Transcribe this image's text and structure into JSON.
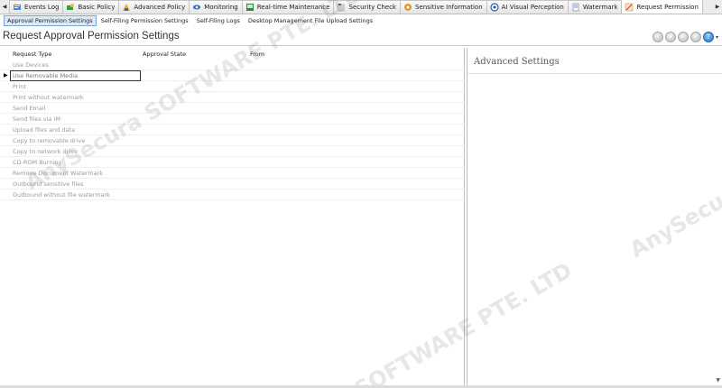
{
  "top_tabs": {
    "scroll_left": "◀",
    "scroll_right": "▶",
    "items": [
      {
        "label": "Events Log",
        "icon": "events-log-icon"
      },
      {
        "label": "Basic Policy",
        "icon": "basic-policy-icon"
      },
      {
        "label": "Advanced Policy",
        "icon": "advanced-policy-icon"
      },
      {
        "label": "Monitoring",
        "icon": "monitoring-icon"
      },
      {
        "label": "Real-time Maintenance",
        "icon": "real-time-maintenance-icon"
      },
      {
        "label": "Security Check",
        "icon": "security-check-icon"
      },
      {
        "label": "Sensitive Information",
        "icon": "sensitive-information-icon"
      },
      {
        "label": "AI Visual Perception",
        "icon": "ai-visual-perception-icon"
      },
      {
        "label": "Watermark",
        "icon": "watermark-icon"
      },
      {
        "label": "Request Permission",
        "icon": "request-permission-icon",
        "active": true
      }
    ]
  },
  "sub_tabs": [
    {
      "label": "Approval Permission Settings",
      "active": true
    },
    {
      "label": "Self-Filing Permission Settings"
    },
    {
      "label": "Self-Filing Logs"
    },
    {
      "label": "Desktop Management File Upload Settings"
    }
  ],
  "header": {
    "title": "Request Approval Permission Settings",
    "toolbar_icons": [
      "check-icon",
      "close-icon",
      "back-icon",
      "confirm-icon",
      "help-icon"
    ],
    "toolbar_caret": "▾"
  },
  "grid": {
    "columns": [
      "Request Type",
      "Approval State",
      "From"
    ],
    "selected_row": 1,
    "row_pointer": "▶",
    "rows": [
      "Use Devices",
      "Use Removable Media",
      "Print",
      "Print without watermark",
      "Send Email",
      "Send files via IM",
      "Upload files and data",
      "Copy to removable drive",
      "Copy to network drive",
      "CD-ROM Burning",
      "Remove Document Watermark",
      "Outbound sensitive files",
      "Outbound without file watermark"
    ]
  },
  "advanced_panel": {
    "title": "Advanced Settings",
    "scroll_down": "▼"
  },
  "watermarks": {
    "wm1": "AnySecura SOFTWARE PTE. LTD",
    "wm2": "SOFTWARE PTE. LTD",
    "wm3": "AnySecu"
  },
  "colors": {
    "accent": "#2a78c4",
    "selected_subtab_bg": "#dce9f7",
    "grid_text": "#9a9a9a"
  }
}
